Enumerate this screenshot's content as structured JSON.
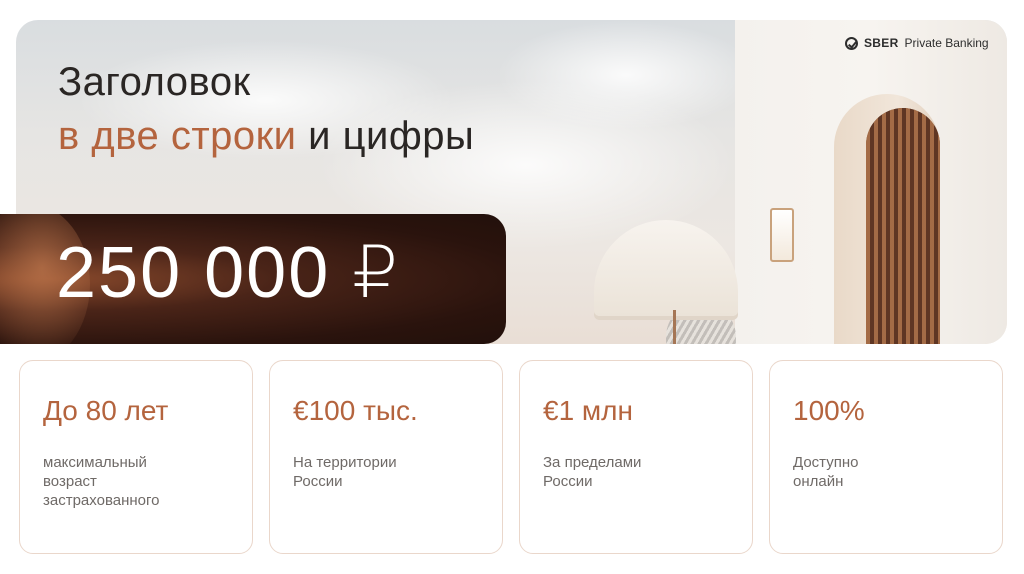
{
  "logo": {
    "brand": "SBER",
    "suffix": "Private Banking"
  },
  "title": {
    "line1": "Заголовок",
    "line2_accent": "в две строки",
    "line2_rest": " и цифры"
  },
  "amount": "250 000 ₽",
  "cards": [
    {
      "value": "До 80 лет",
      "description": "максимальный\nвозраст\nзастрахованного"
    },
    {
      "value": "€100 тыс.",
      "description": "На территории\nРоссии"
    },
    {
      "value": "€1 млн",
      "description": "За пределами\nРоссии"
    },
    {
      "value": "100%",
      "description": "Доступно\nонлайн"
    }
  ],
  "colors": {
    "accent": "#b4643e",
    "dark_block": "#2a130d",
    "card_border": "#ead7cb"
  }
}
